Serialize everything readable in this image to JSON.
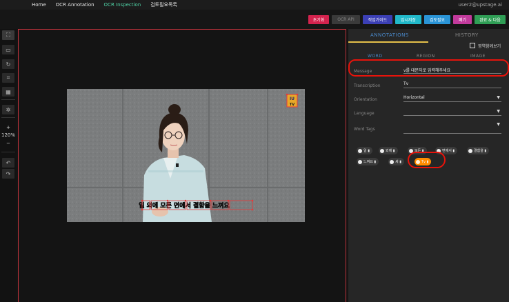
{
  "nav": {
    "items": [
      "Home",
      "OCR Annotation",
      "OCR Inspection",
      "검토필요목록"
    ],
    "active_index": 2,
    "user": "user2@upstage.ai"
  },
  "toolbar": {
    "buttons": [
      {
        "label": "초기화",
        "color": "#d4234e"
      },
      {
        "label": "OCR API",
        "color": "#3a3a3a"
      },
      {
        "label": "작업가이드",
        "color": "#3b3fb5"
      },
      {
        "label": "임시저장",
        "color": "#21b8c9"
      },
      {
        "label": "검토필요",
        "color": "#2a94d6"
      },
      {
        "label": "폐기",
        "color": "#c23a9c"
      },
      {
        "label": "완료 & 다음",
        "color": "#2f9e55"
      }
    ]
  },
  "tools": {
    "zoom": "120%",
    "plus": "+",
    "minus": "−"
  },
  "panel": {
    "tabs": [
      "ANNOTATIONS",
      "HISTORY"
    ],
    "checkbox_label": "영역함께보기",
    "subtabs": [
      "WORD",
      "REGION",
      "IMAGE"
    ],
    "fields": [
      {
        "label": "Message",
        "value": "v를 대문자로 입력해주세요"
      },
      {
        "label": "Transcription",
        "value": "Tv"
      },
      {
        "label": "Orientation",
        "value": "Horizontal"
      },
      {
        "label": "Language",
        "value": ""
      },
      {
        "label": "Word Tags",
        "value": ""
      }
    ],
    "chips_row1": [
      "일",
      "외에",
      "모든",
      "면에서",
      "결함을"
    ],
    "chips_row2": [
      "느껴요",
      "세",
      "Tv"
    ]
  },
  "image": {
    "caption": "일 외에 모든 면에서 결함을 느껴요",
    "logo_top": "IU",
    "logo_bottom": "TV"
  },
  "colors": {
    "accent": "#e5c14a",
    "highlight": "#e8130b",
    "active_chip": "#ff8c00",
    "bbox": "#e53a3a"
  }
}
